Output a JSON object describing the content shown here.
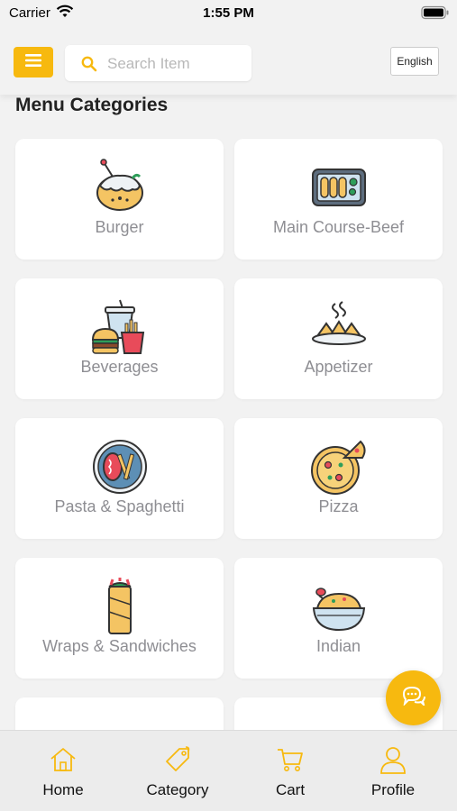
{
  "status_bar": {
    "carrier": "Carrier",
    "time": "1:55 PM"
  },
  "header": {
    "menu_icon": "hamburger-icon",
    "search": {
      "placeholder": "Search Item",
      "value": ""
    },
    "language": "English"
  },
  "main": {
    "title": "Menu Categories",
    "categories": [
      {
        "label": "Burger",
        "icon": "burger-icon"
      },
      {
        "label": "Main Course-Beef",
        "icon": "main-course-icon"
      },
      {
        "label": "Beverages",
        "icon": "beverages-icon"
      },
      {
        "label": "Appetizer",
        "icon": "appetizer-icon"
      },
      {
        "label": "Pasta & Spaghetti",
        "icon": "pasta-icon"
      },
      {
        "label": "Pizza",
        "icon": "pizza-icon"
      },
      {
        "label": "Wraps & Sandwiches",
        "icon": "wrap-icon"
      },
      {
        "label": "Indian",
        "icon": "indian-icon"
      },
      {
        "label": "",
        "icon": "partial-food-icon"
      },
      {
        "label": "",
        "icon": "partial-food-icon"
      }
    ]
  },
  "chat_button": {
    "icon": "chat-icon"
  },
  "bottom_nav": [
    {
      "label": "Home",
      "icon": "home-icon"
    },
    {
      "label": "Category",
      "icon": "tag-icon"
    },
    {
      "label": "Cart",
      "icon": "cart-icon"
    },
    {
      "label": "Profile",
      "icon": "profile-icon"
    }
  ],
  "colors": {
    "accent": "#f7b90f",
    "background": "#f2f2f2",
    "card": "#ffffff",
    "label_gray": "#8e8e93"
  }
}
